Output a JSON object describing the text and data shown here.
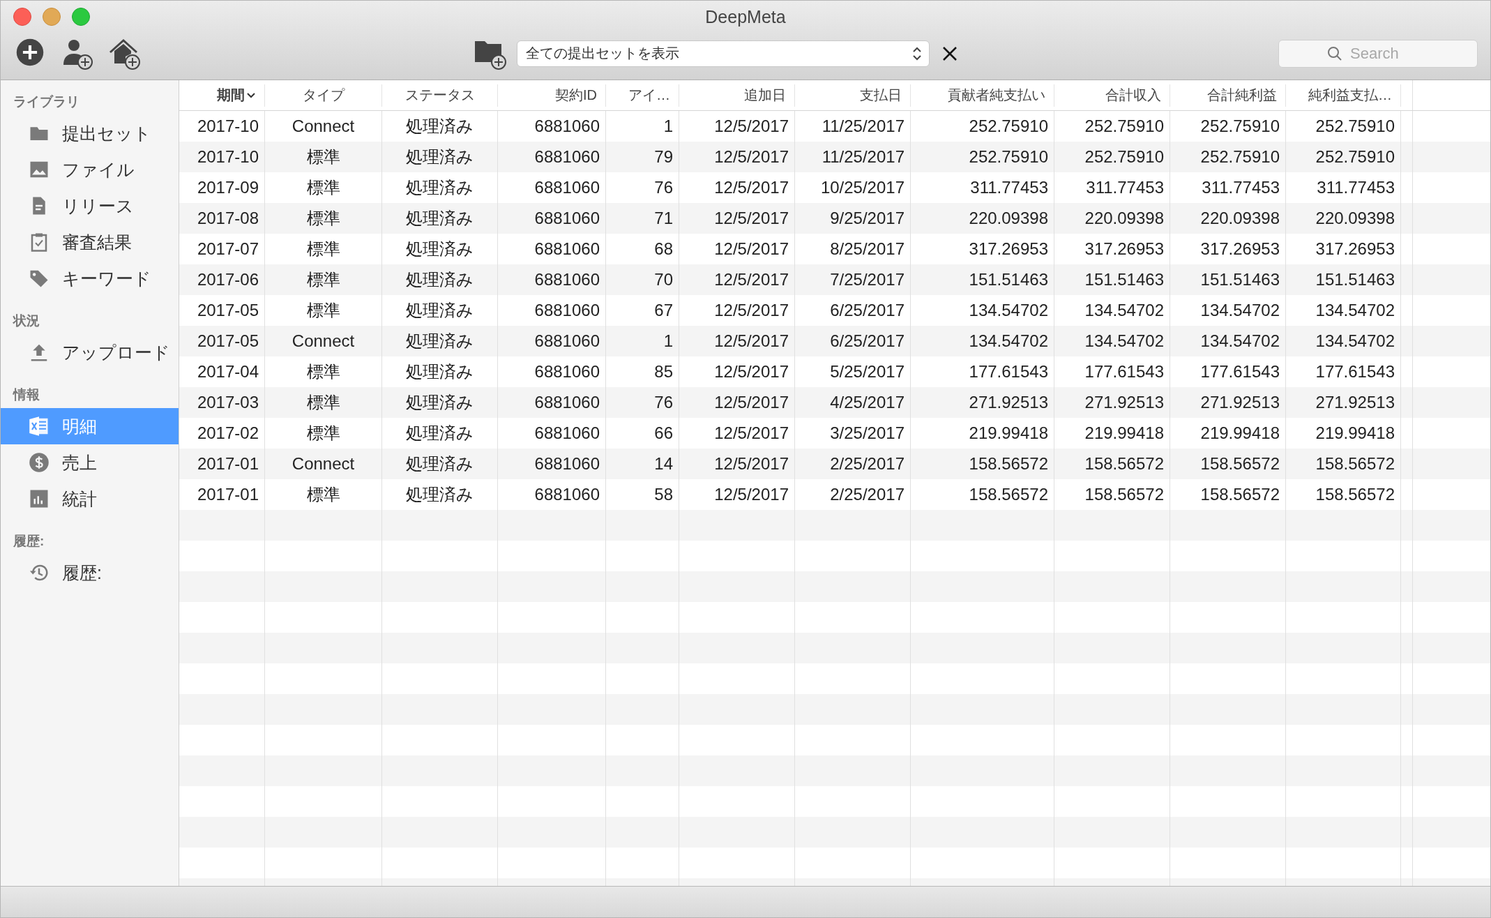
{
  "window": {
    "title": "DeepMeta"
  },
  "toolbar": {
    "filter": {
      "value": "全ての提出セットを表示"
    },
    "search": {
      "placeholder": "Search"
    }
  },
  "sidebar": {
    "sections": [
      {
        "title": "ライブラリ",
        "items": [
          {
            "label": "提出セット",
            "selected": false
          },
          {
            "label": "ファイル",
            "selected": false
          },
          {
            "label": "リリース",
            "selected": false
          },
          {
            "label": "審査結果",
            "selected": false
          },
          {
            "label": "キーワード",
            "selected": false
          }
        ]
      },
      {
        "title": "状況",
        "items": [
          {
            "label": "アップロード",
            "selected": false
          }
        ]
      },
      {
        "title": "情報",
        "items": [
          {
            "label": "明細",
            "selected": true
          },
          {
            "label": "売上",
            "selected": false
          },
          {
            "label": "統計",
            "selected": false
          }
        ]
      },
      {
        "title": "履歴:",
        "items": [
          {
            "label": "履歴:",
            "selected": false
          }
        ]
      }
    ]
  },
  "table": {
    "columns": [
      {
        "label": "期間",
        "sorted": true
      },
      {
        "label": "タイプ",
        "sorted": false
      },
      {
        "label": "ステータス",
        "sorted": false
      },
      {
        "label": "契約ID",
        "sorted": false
      },
      {
        "label": "アイ…",
        "sorted": false
      },
      {
        "label": "追加日",
        "sorted": false
      },
      {
        "label": "支払日",
        "sorted": false
      },
      {
        "label": "貢献者純支払い",
        "sorted": false
      },
      {
        "label": "合計収入",
        "sorted": false
      },
      {
        "label": "合計純利益",
        "sorted": false
      },
      {
        "label": "純利益支払…",
        "sorted": false
      }
    ],
    "rows": [
      [
        "2017-10",
        "Connect",
        "処理済み",
        "6881060",
        "1",
        "12/5/2017",
        "11/25/2017",
        "252.75910",
        "252.75910",
        "252.75910",
        "252.75910"
      ],
      [
        "2017-10",
        "標準",
        "処理済み",
        "6881060",
        "79",
        "12/5/2017",
        "11/25/2017",
        "252.75910",
        "252.75910",
        "252.75910",
        "252.75910"
      ],
      [
        "2017-09",
        "標準",
        "処理済み",
        "6881060",
        "76",
        "12/5/2017",
        "10/25/2017",
        "311.77453",
        "311.77453",
        "311.77453",
        "311.77453"
      ],
      [
        "2017-08",
        "標準",
        "処理済み",
        "6881060",
        "71",
        "12/5/2017",
        "9/25/2017",
        "220.09398",
        "220.09398",
        "220.09398",
        "220.09398"
      ],
      [
        "2017-07",
        "標準",
        "処理済み",
        "6881060",
        "68",
        "12/5/2017",
        "8/25/2017",
        "317.26953",
        "317.26953",
        "317.26953",
        "317.26953"
      ],
      [
        "2017-06",
        "標準",
        "処理済み",
        "6881060",
        "70",
        "12/5/2017",
        "7/25/2017",
        "151.51463",
        "151.51463",
        "151.51463",
        "151.51463"
      ],
      [
        "2017-05",
        "標準",
        "処理済み",
        "6881060",
        "67",
        "12/5/2017",
        "6/25/2017",
        "134.54702",
        "134.54702",
        "134.54702",
        "134.54702"
      ],
      [
        "2017-05",
        "Connect",
        "処理済み",
        "6881060",
        "1",
        "12/5/2017",
        "6/25/2017",
        "134.54702",
        "134.54702",
        "134.54702",
        "134.54702"
      ],
      [
        "2017-04",
        "標準",
        "処理済み",
        "6881060",
        "85",
        "12/5/2017",
        "5/25/2017",
        "177.61543",
        "177.61543",
        "177.61543",
        "177.61543"
      ],
      [
        "2017-03",
        "標準",
        "処理済み",
        "6881060",
        "76",
        "12/5/2017",
        "4/25/2017",
        "271.92513",
        "271.92513",
        "271.92513",
        "271.92513"
      ],
      [
        "2017-02",
        "標準",
        "処理済み",
        "6881060",
        "66",
        "12/5/2017",
        "3/25/2017",
        "219.99418",
        "219.99418",
        "219.99418",
        "219.99418"
      ],
      [
        "2017-01",
        "Connect",
        "処理済み",
        "6881060",
        "14",
        "12/5/2017",
        "2/25/2017",
        "158.56572",
        "158.56572",
        "158.56572",
        "158.56572"
      ],
      [
        "2017-01",
        "標準",
        "処理済み",
        "6881060",
        "58",
        "12/5/2017",
        "2/25/2017",
        "158.56572",
        "158.56572",
        "158.56572",
        "158.56572"
      ]
    ]
  }
}
